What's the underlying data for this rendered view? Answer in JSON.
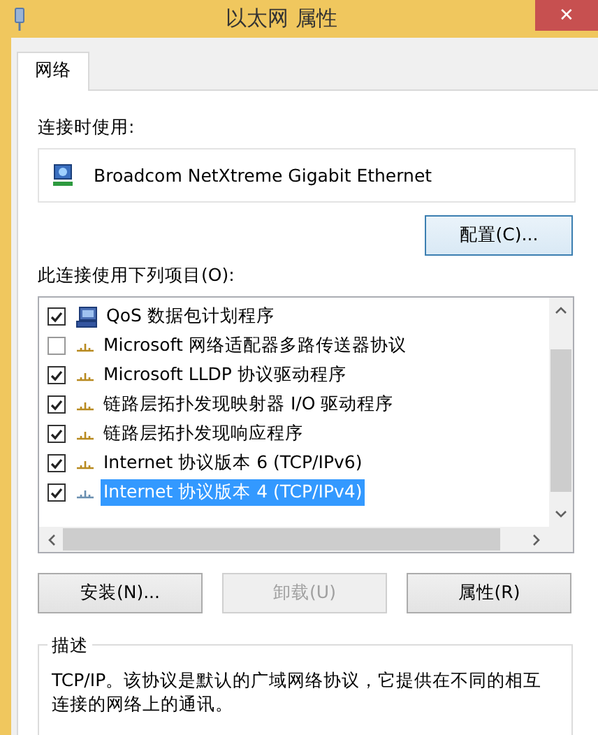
{
  "window": {
    "title": "以太网 属性",
    "close": "✕"
  },
  "tabs": [
    {
      "label": "网络",
      "selected": true
    }
  ],
  "connect_using": {
    "label": "连接时使用:",
    "adapter": "Broadcom NetXtreme Gigabit Ethernet"
  },
  "configure_button": "配置(C)...",
  "items_label": "此连接使用下列项目(O):",
  "items": [
    {
      "label": "QoS 数据包计划程序",
      "kind": "service",
      "checked": true,
      "selected": false
    },
    {
      "label": "Microsoft 网络适配器多路传送器协议",
      "kind": "protocol",
      "checked": false,
      "selected": false
    },
    {
      "label": "Microsoft LLDP 协议驱动程序",
      "kind": "protocol",
      "checked": true,
      "selected": false
    },
    {
      "label": "链路层拓扑发现映射器 I/O 驱动程序",
      "kind": "protocol",
      "checked": true,
      "selected": false
    },
    {
      "label": "链路层拓扑发现响应程序",
      "kind": "protocol",
      "checked": true,
      "selected": false
    },
    {
      "label": "Internet 协议版本 6 (TCP/IPv6)",
      "kind": "protocol",
      "checked": true,
      "selected": false
    },
    {
      "label": "Internet 协议版本 4 (TCP/IPv4)",
      "kind": "protocol",
      "checked": true,
      "selected": true
    }
  ],
  "buttons": [
    {
      "label": "安装(N)...",
      "disabled": false
    },
    {
      "label": "卸载(U)",
      "disabled": true
    },
    {
      "label": "属性(R)",
      "disabled": false
    }
  ],
  "description": {
    "label": "描述",
    "text": "TCP/IP。该协议是默认的广域网络协议，它提供在不同的相互连接的网络上的通讯。"
  }
}
